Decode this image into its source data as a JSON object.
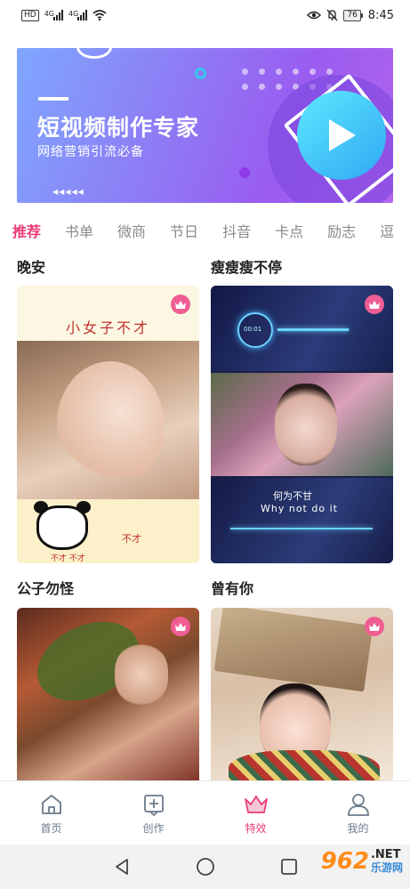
{
  "status_bar": {
    "left_chip": "HD",
    "signal_1_label": "4G",
    "signal_2_label": "4G",
    "battery": "76",
    "time": "8:45"
  },
  "banner": {
    "title": "短视频制作专家",
    "subtitle": "网络营销引流必备",
    "arrows": "◀◀◀◀◀"
  },
  "tabs": [
    {
      "label": "推荐",
      "active": true
    },
    {
      "label": "书单"
    },
    {
      "label": "微商"
    },
    {
      "label": "节日"
    },
    {
      "label": "抖音"
    },
    {
      "label": "卡点"
    },
    {
      "label": "励志"
    },
    {
      "label": "逗"
    }
  ],
  "sections": [
    {
      "title": "晚安",
      "card": {
        "header_text": "小女子不才",
        "sub_text_a": "不才",
        "sub_text_b": "不才  不才"
      }
    },
    {
      "title": "瘦瘦瘦不停",
      "card": {
        "clock_text": "00:01",
        "caption_cn": "何为不甘",
        "caption_en": "Why not do it"
      }
    },
    {
      "title": "公子勿怪"
    },
    {
      "title": "曾有你"
    }
  ],
  "bottom_nav": [
    {
      "label": "首页",
      "icon": "home-icon"
    },
    {
      "label": "创作",
      "icon": "create-icon"
    },
    {
      "label": "特效",
      "icon": "crown-icon",
      "active": true
    },
    {
      "label": "我的",
      "icon": "user-icon"
    }
  ],
  "watermark": {
    "number": "962",
    "suffix": ".NET",
    "cn": "乐游网"
  },
  "colors": {
    "accent": "#ea3c7a",
    "crown_badge": "#ef5d93",
    "banner_start": "#7fa7ff",
    "banner_end": "#b264ec"
  }
}
